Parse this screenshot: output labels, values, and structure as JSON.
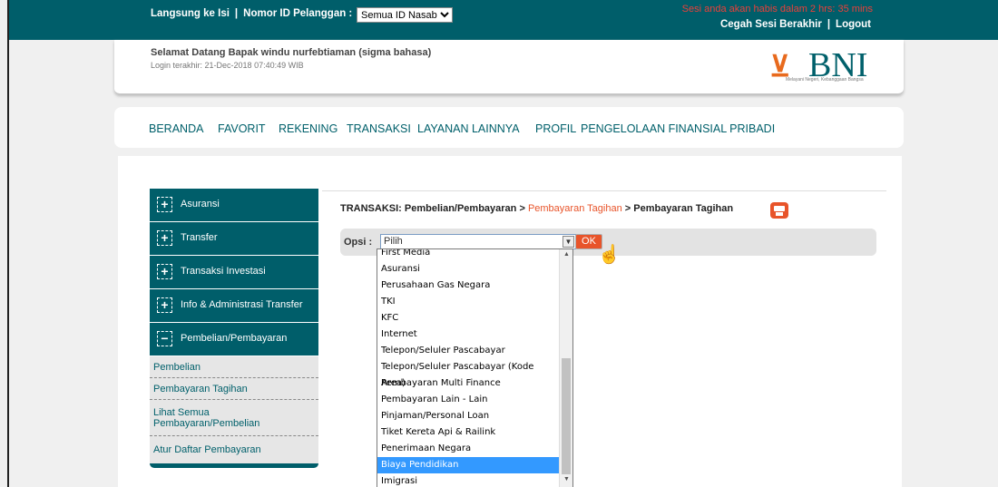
{
  "topbar": {
    "jump_label": "Langsung ke Isi",
    "sep": "|",
    "customer_id_label": "Nomor ID Pelanggan :",
    "customer_id_value": "Semua ID Nasabah",
    "session_warning": "Sesi anda akan habis dalam 2 hrs: 35 mins",
    "prevent_session_end": "Cegah Sesi Berakhir",
    "logout": "Logout"
  },
  "welcome": {
    "greeting": "Selamat Datang Bapak windu nurfebtiaman (sigma bahasa)",
    "last_login": "Login terakhir:  21-Dec-2018 07:40:49  WIB"
  },
  "logo": {
    "brand": "BNI",
    "tagline": "Melayani Negeri, Kebanggaan Bangsa"
  },
  "nav": {
    "items": [
      "BERANDA",
      "FAVORIT",
      "REKENING",
      "TRANSAKSI",
      "LAYANAN LAINNYA",
      "PROFIL",
      "PENGELOLAAN FINANSIAL PRIBADI"
    ]
  },
  "sidebar": {
    "sections": [
      {
        "sign": "+",
        "label": "Asuransi"
      },
      {
        "sign": "+",
        "label": "Transfer"
      },
      {
        "sign": "+",
        "label": "Transaksi Investasi"
      },
      {
        "sign": "+",
        "label": "Info & Administrasi Transfer"
      },
      {
        "sign": "−",
        "label": "Pembelian/Pembayaran"
      }
    ],
    "subitems": [
      "Pembelian",
      "Pembayaran Tagihan",
      "Lihat Semua Pembayaran/Pembelian",
      "Atur Daftar Pembayaran"
    ]
  },
  "breadcrumb": {
    "part1": "TRANSAKSI: Pembelian/Pembayaran > ",
    "part2": "Pembayaran Tagihan",
    "part3": " > Pembayaran Tagihan"
  },
  "form": {
    "option_label": "Opsi :",
    "selected": "Pilih",
    "ok_label": "OK"
  },
  "dropdown": {
    "options": [
      "First Media",
      "Asuransi",
      "Perusahaan Gas Negara",
      "TKI",
      "KFC",
      "Internet",
      "Telepon/Seluler Pascabayar",
      "Telepon/Seluler Pascabayar (Kode Area)",
      "Pembayaran Multi Finance",
      "Pembayaran Lain - Lain",
      "Pinjaman/Personal Loan",
      "Tiket Kereta Api & Railink",
      "Penerimaan Negara",
      "Biaya Pendidikan",
      "Imigrasi"
    ],
    "highlighted": "Biaya Pendidikan"
  }
}
